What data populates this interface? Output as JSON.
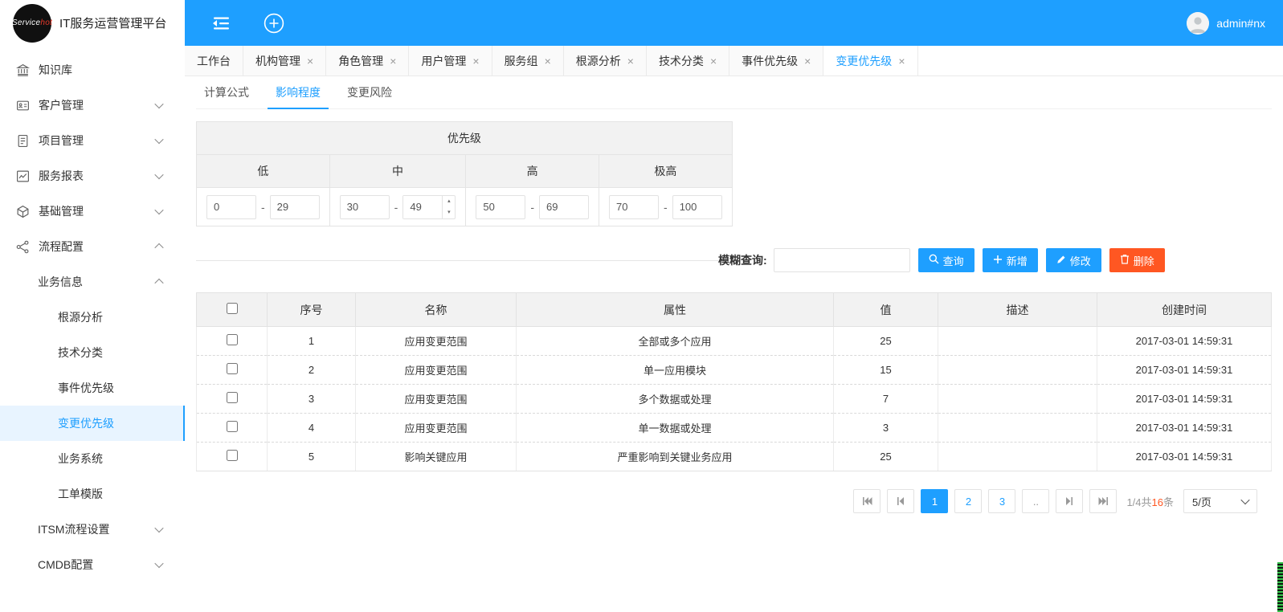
{
  "app": {
    "platform_title": "IT服务运营管理平台",
    "logo_service": "Service",
    "logo_hot": "hot",
    "user_name": "admin#nx"
  },
  "colors": {
    "accent": "#1E9FFF",
    "danger": "#FF5722"
  },
  "icons": {
    "close": "×",
    "spinner_up": "▴",
    "spinner_down": "▾"
  },
  "sidebar": {
    "items": [
      {
        "label": "知识库"
      },
      {
        "label": "客户管理"
      },
      {
        "label": "项目管理"
      },
      {
        "label": "服务报表"
      },
      {
        "label": "基础管理"
      },
      {
        "label": "流程配置"
      },
      {
        "label": "业务信息"
      },
      {
        "label": "根源分析"
      },
      {
        "label": "技术分类"
      },
      {
        "label": "事件优先级"
      },
      {
        "label": "变更优先级"
      },
      {
        "label": "业务系统"
      },
      {
        "label": "工单模版"
      },
      {
        "label": "ITSM流程设置"
      },
      {
        "label": "CMDB配置"
      }
    ]
  },
  "tabs": [
    {
      "label": "工作台"
    },
    {
      "label": "机构管理"
    },
    {
      "label": "角色管理"
    },
    {
      "label": "用户管理"
    },
    {
      "label": "服务组"
    },
    {
      "label": "根源分析"
    },
    {
      "label": "技术分类"
    },
    {
      "label": "事件优先级"
    },
    {
      "label": "变更优先级"
    }
  ],
  "subtabs": [
    {
      "label": "计算公式"
    },
    {
      "label": "影响程度"
    },
    {
      "label": "变更风险"
    }
  ],
  "priority": {
    "title": "优先级",
    "range_separator": "-",
    "levels": [
      {
        "name": "低",
        "min": "0",
        "max": "29"
      },
      {
        "name": "中",
        "min": "30",
        "max": "49"
      },
      {
        "name": "高",
        "min": "50",
        "max": "69"
      },
      {
        "name": "极高",
        "min": "70",
        "max": "100"
      }
    ]
  },
  "search": {
    "label": "模糊查询:",
    "value": ""
  },
  "actions": {
    "query": "查询",
    "add": "新增",
    "edit": "修改",
    "delete": "删除"
  },
  "table": {
    "columns": [
      "序号",
      "名称",
      "属性",
      "值",
      "描述",
      "创建时间"
    ],
    "rows": [
      {
        "no": "1",
        "name": "应用变更范围",
        "attr": "全部或多个应用",
        "value": "25",
        "desc": "",
        "created": "2017-03-01 14:59:31"
      },
      {
        "no": "2",
        "name": "应用变更范围",
        "attr": "单一应用模块",
        "value": "15",
        "desc": "",
        "created": "2017-03-01 14:59:31"
      },
      {
        "no": "3",
        "name": "应用变更范围",
        "attr": "多个数据或处理",
        "value": "7",
        "desc": "",
        "created": "2017-03-01 14:59:31"
      },
      {
        "no": "4",
        "name": "应用变更范围",
        "attr": "单一数据或处理",
        "value": "3",
        "desc": "",
        "created": "2017-03-01 14:59:31"
      },
      {
        "no": "5",
        "name": "影响关键应用",
        "attr": "严重影响到关键业务应用",
        "value": "25",
        "desc": "",
        "created": "2017-03-01 14:59:31"
      }
    ]
  },
  "pagination": {
    "pages": [
      {
        "label": "1"
      },
      {
        "label": "2"
      },
      {
        "label": "3"
      },
      {
        "label": ".."
      }
    ],
    "current": "1",
    "info_prefix": "1/4共",
    "info_count": "16",
    "info_suffix": "条",
    "page_size": "5/页"
  }
}
